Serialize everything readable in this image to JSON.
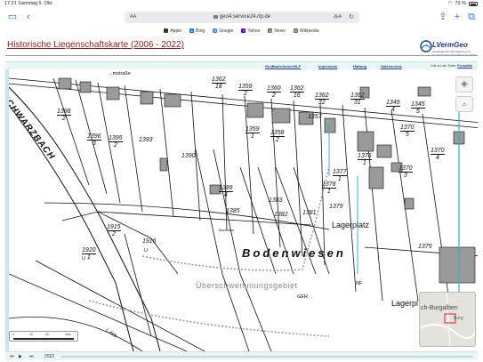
{
  "status_bar": {
    "time": "17:21",
    "date": "Samstag 5. Okt.",
    "battery": "73 %"
  },
  "browser": {
    "aa_label": "AA",
    "url": "geo4.service24.rlp.de",
    "translate_label": "⁂A",
    "bookmarks": [
      {
        "label": "Apple",
        "icon": "apple-icon",
        "color": "#333333",
        "glyph": ""
      },
      {
        "label": "Bing",
        "icon": "bing-icon",
        "color": "#1a73e8",
        "glyph": "b"
      },
      {
        "label": "Google",
        "icon": "google-icon",
        "color": "#4285f4",
        "glyph": "G"
      },
      {
        "label": "Yahoo",
        "icon": "yahoo-icon",
        "color": "#5f01d1",
        "glyph": "Y"
      },
      {
        "label": "News",
        "icon": "news-icon",
        "color": "#555555",
        "glyph": "▤"
      },
      {
        "label": "Wikipedia",
        "icon": "wikipedia-icon",
        "color": "#666666",
        "glyph": "W"
      }
    ]
  },
  "page": {
    "title": "Historische Liegenschaftskarte (2006 - 2022)",
    "logo_text": "LVermGeo",
    "logo_subtitle": "Landesamt für Vermessung und Geobasisinformation Rheinland-Pfalz",
    "links": [
      "GeoBasisViewer.RLP",
      "Impressum",
      "Haftung",
      "Datenschutz"
    ],
    "link_note": "Link zur akt. Karte:",
    "permalink": "Permalink"
  },
  "map": {
    "water_label": "SCHWARZBACH",
    "street_top": "...mstraße",
    "area_label": "Bodenwiesen",
    "flood_label": "Überschwemmungsgebiet",
    "lager_label": "Lagerplatz",
    "lager_label2": "Lagerpl",
    "road_label": "L 498",
    "bachland": "Bachland",
    "small_labels": [
      "GER",
      "NF",
      "U",
      "U"
    ],
    "parcels": [
      {
        "label": "1362",
        "sub": "18"
      },
      {
        "label": "1359",
        "sub": "2"
      },
      {
        "label": "1360",
        "sub": "2"
      },
      {
        "label": "1362",
        "sub": "16"
      },
      {
        "label": "1362",
        "sub": "32"
      },
      {
        "label": "1362",
        "sub": "31"
      },
      {
        "label": "1349",
        "sub": "4"
      },
      {
        "label": "1345",
        "sub": "5"
      },
      {
        "label": "1398",
        "sub": "2"
      },
      {
        "label": "1396",
        "sub": "3"
      },
      {
        "label": "1395",
        "sub": "2"
      },
      {
        "label": "1393",
        "sub": ""
      },
      {
        "label": "1359",
        "sub": "1"
      },
      {
        "label": "1358",
        "sub": "2"
      },
      {
        "label": "1357",
        "sub": ""
      },
      {
        "label": "1370",
        "sub": "5"
      },
      {
        "label": "1370",
        "sub": "4"
      },
      {
        "label": "1376",
        "sub": "1"
      },
      {
        "label": "1390",
        "sub": ""
      },
      {
        "label": "1370",
        "sub": "3"
      },
      {
        "label": "1378",
        "sub": "1"
      },
      {
        "label": "1386",
        "sub": "4"
      },
      {
        "label": "1383",
        "sub": ""
      },
      {
        "label": "1385",
        "sub": ""
      },
      {
        "label": "1382",
        "sub": ""
      },
      {
        "label": "1381",
        "sub": ""
      },
      {
        "label": "1379",
        "sub": ""
      },
      {
        "label": "1915",
        "sub": "2"
      },
      {
        "label": "1916",
        "sub": ""
      },
      {
        "label": "1920",
        "sub": "1"
      },
      {
        "label": "1375",
        "sub": ""
      },
      {
        "label": "1377",
        "sub": "1"
      }
    ],
    "overview_label": "ch-Burgalben",
    "overview_label2": "Burg"
  },
  "scale": {
    "ticks": [
      "0",
      "10",
      "20",
      "30m"
    ]
  },
  "timeline": {
    "year": "2022"
  }
}
